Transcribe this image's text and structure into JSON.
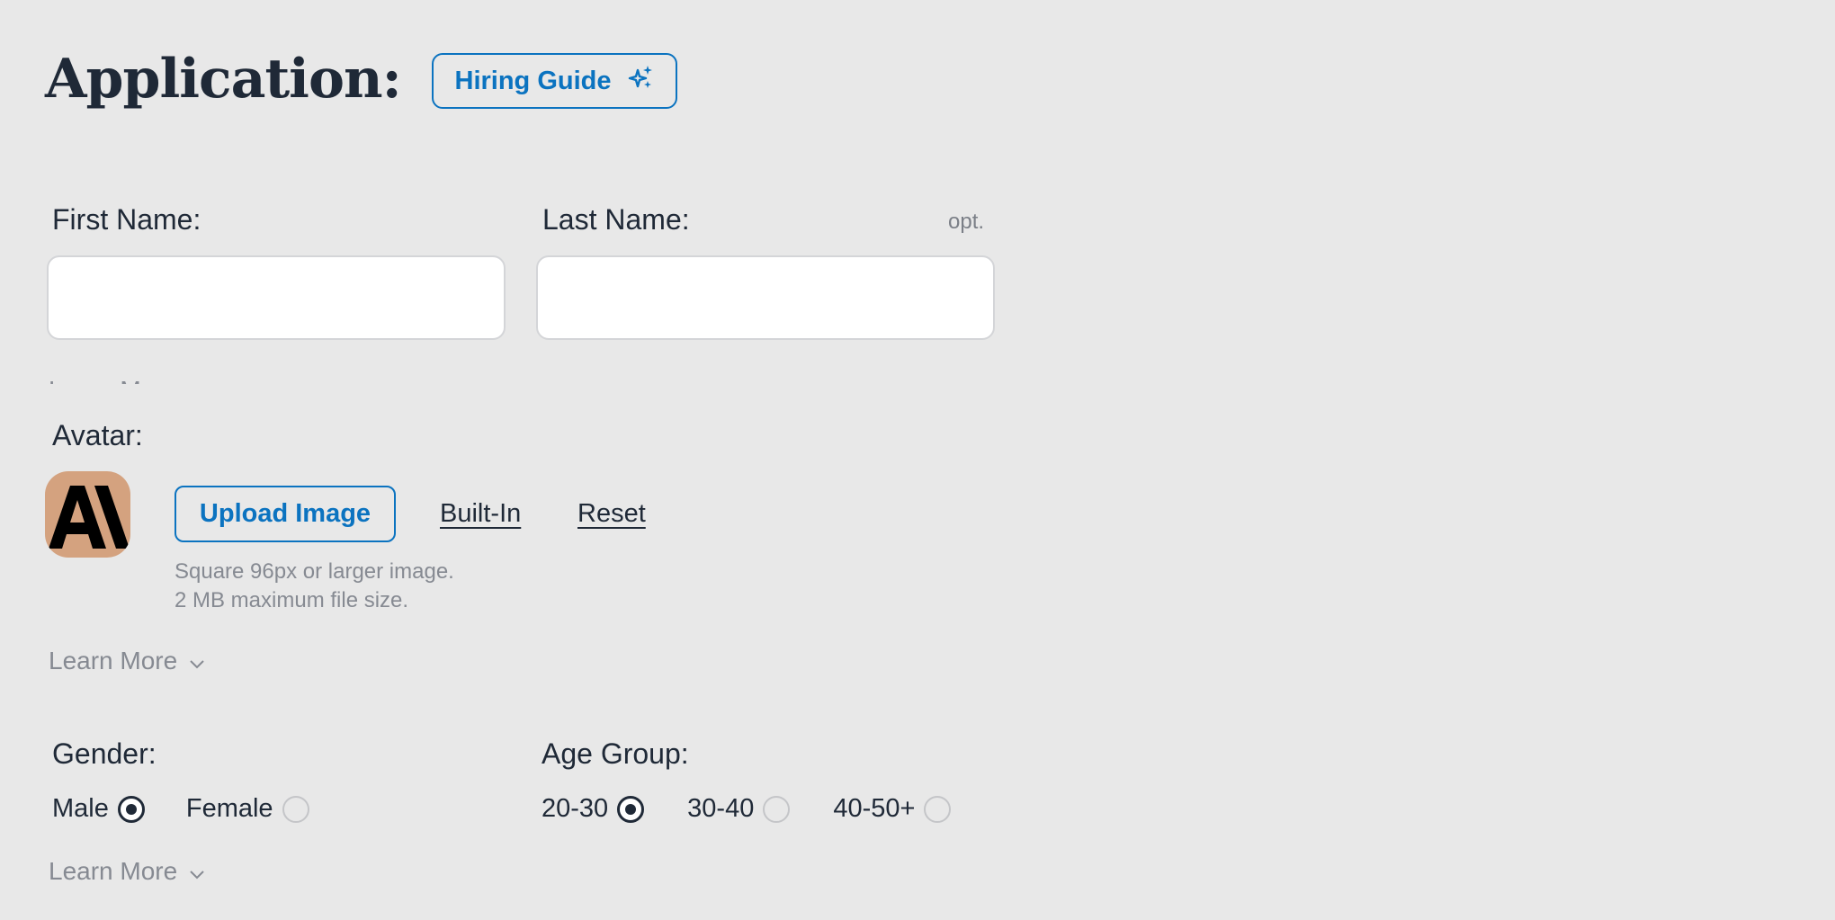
{
  "header": {
    "title": "Application:",
    "guide_button": {
      "label": "Hiring Guide",
      "icon": "sparkles-icon"
    }
  },
  "name_fields": {
    "first_name": {
      "label": "First Name:",
      "value": "",
      "placeholder": ""
    },
    "last_name": {
      "label": "Last Name:",
      "optional_tag": "opt.",
      "value": "",
      "placeholder": ""
    },
    "learn_more": "Learn More"
  },
  "avatar": {
    "label": "Avatar:",
    "image_text": "AI",
    "upload_button": "Upload Image",
    "builtin_link": "Built-In",
    "reset_link": "Reset",
    "help_lines": [
      "Square 96px or larger image.",
      "2 MB maximum file size."
    ],
    "learn_more": "Learn More"
  },
  "gender": {
    "label": "Gender:",
    "options": [
      {
        "label": "Male",
        "checked": true
      },
      {
        "label": "Female",
        "checked": false
      }
    ]
  },
  "age_group": {
    "label": "Age Group:",
    "options": [
      {
        "label": "20-30",
        "checked": true
      },
      {
        "label": "30-40",
        "checked": false
      },
      {
        "label": "40-50+",
        "checked": false
      }
    ]
  },
  "demographics_learn_more": "Learn More",
  "colors": {
    "background": "#e8e8e8",
    "accent": "#0b73c0",
    "text": "#1f2937",
    "muted": "#868a92",
    "avatar_bg": "#d4a27f"
  }
}
